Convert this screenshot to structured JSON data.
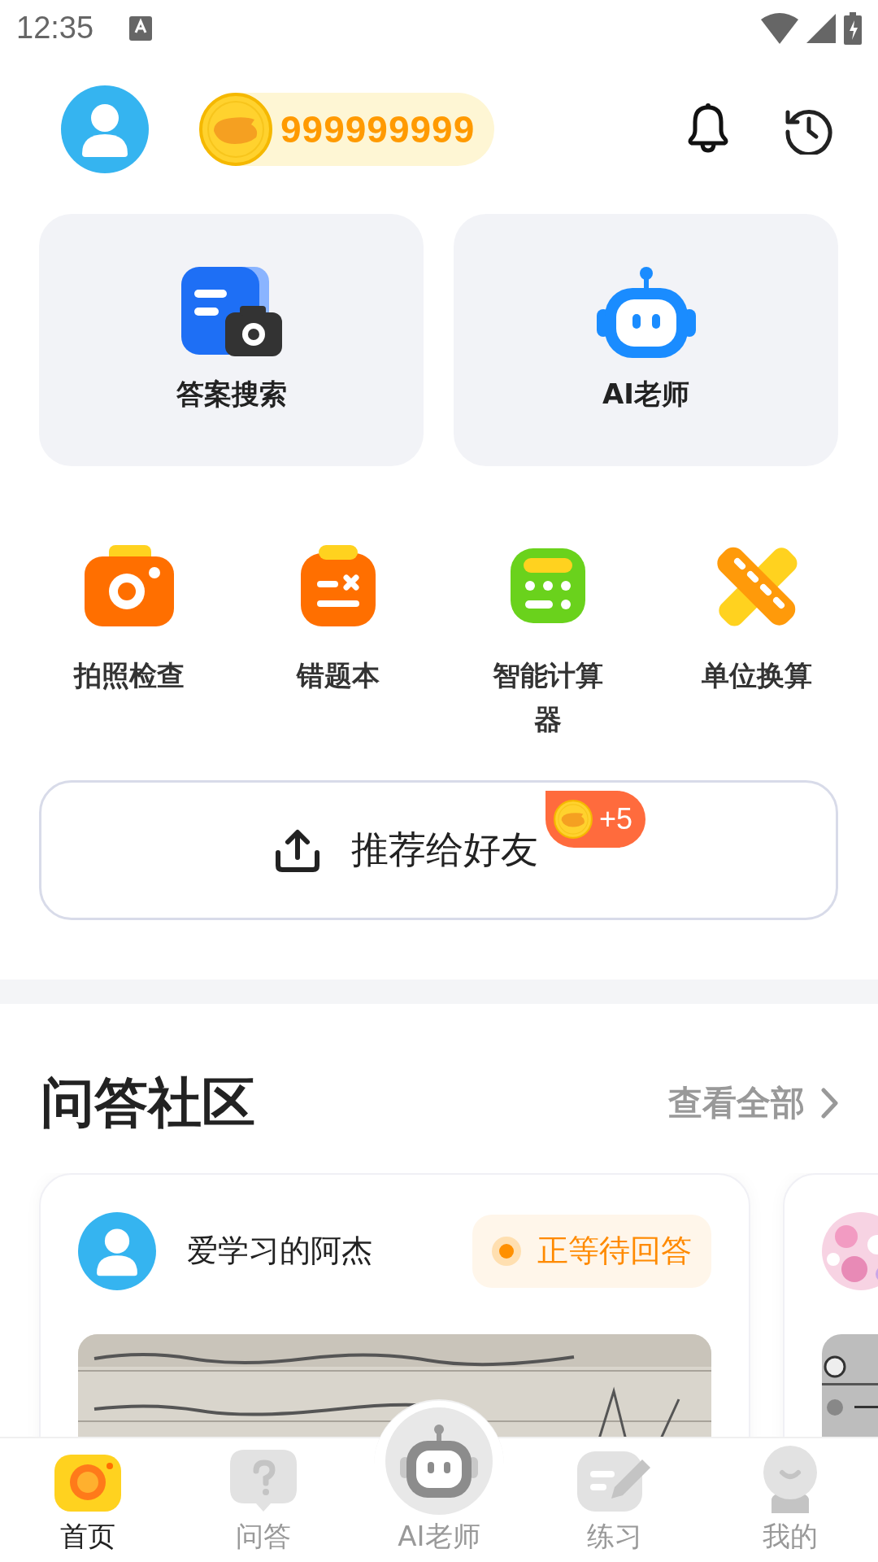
{
  "status_bar": {
    "time": "12:35"
  },
  "header": {
    "coins": "999999999"
  },
  "main_tiles": [
    {
      "kind": "search",
      "label": "答案搜索"
    },
    {
      "kind": "robot",
      "label": "AI老师"
    }
  ],
  "tools": [
    {
      "kind": "camera",
      "label": "拍照检查"
    },
    {
      "kind": "notebook",
      "label": "错题本"
    },
    {
      "kind": "calculator",
      "label": "智能计算器"
    },
    {
      "kind": "ruler",
      "label": "单位换算"
    }
  ],
  "share": {
    "label": "推荐给好友",
    "bonus": "+5"
  },
  "community": {
    "title": "问答社区",
    "view_all": "查看全部",
    "posts": [
      {
        "user": "爱学习的阿杰",
        "status": "正等待回答",
        "image": {
          "kind": "picture"
        }
      },
      {
        "image": {
          "kind": "picture"
        }
      }
    ]
  },
  "bottom_nav": [
    {
      "kind": "home",
      "label": "首页",
      "selected": true
    },
    {
      "kind": "qa",
      "label": "问答",
      "selected": false
    },
    {
      "kind": "robot",
      "label": "AI老师",
      "selected": false
    },
    {
      "kind": "practice",
      "label": "练习",
      "selected": false
    },
    {
      "kind": "profile",
      "label": "我的",
      "selected": false
    }
  ]
}
